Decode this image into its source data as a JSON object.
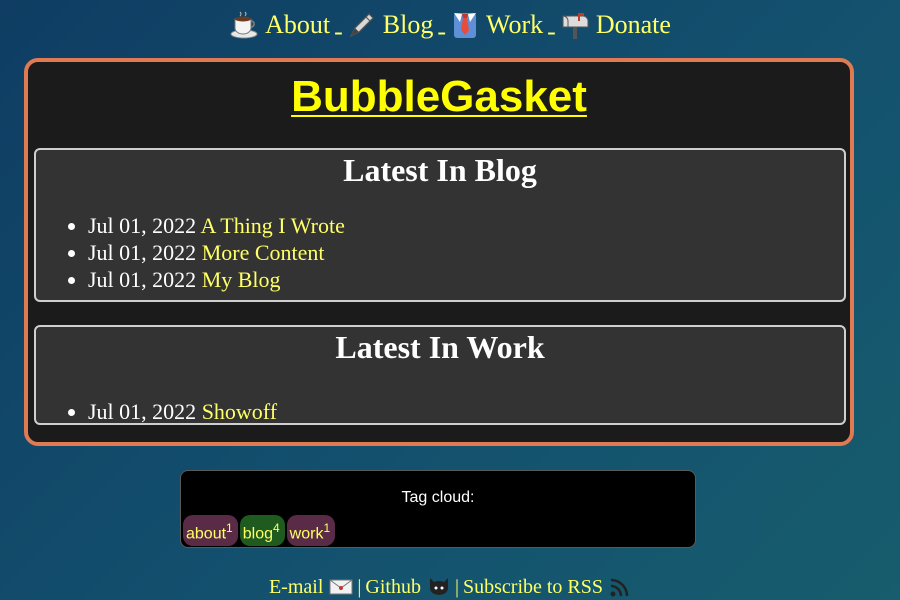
{
  "nav": {
    "items": [
      {
        "label": "About",
        "icon": "coffee-icon"
      },
      {
        "label": "Blog",
        "icon": "pen-icon"
      },
      {
        "label": "Work",
        "icon": "necktie-icon"
      },
      {
        "label": "Donate",
        "icon": "mailbox-icon"
      }
    ],
    "separator": "-"
  },
  "site": {
    "title": "BubbleGasket"
  },
  "blog": {
    "heading": "Latest In Blog",
    "posts": [
      {
        "date": "Jul 01, 2022",
        "title": "A Thing I Wrote"
      },
      {
        "date": "Jul 01, 2022",
        "title": "More Content"
      },
      {
        "date": "Jul 01, 2022",
        "title": "My Blog"
      }
    ]
  },
  "work": {
    "heading": "Latest In Work",
    "posts": [
      {
        "date": "Jul 01, 2022",
        "title": "Showoff"
      }
    ]
  },
  "tagcloud": {
    "title": "Tag cloud:",
    "tags": [
      {
        "name": "about",
        "count": "1"
      },
      {
        "name": "blog",
        "count": "4"
      },
      {
        "name": "work",
        "count": "1"
      }
    ]
  },
  "footer": {
    "email": "E-mail",
    "github": "Github",
    "rss": "Subscribe to RSS",
    "separator": "|"
  },
  "colors": {
    "link": "#ffff66",
    "title": "#ffff00",
    "panel_border": "#e07a52",
    "panel_bg": "#1b1b1b",
    "section_bg": "#333333"
  }
}
